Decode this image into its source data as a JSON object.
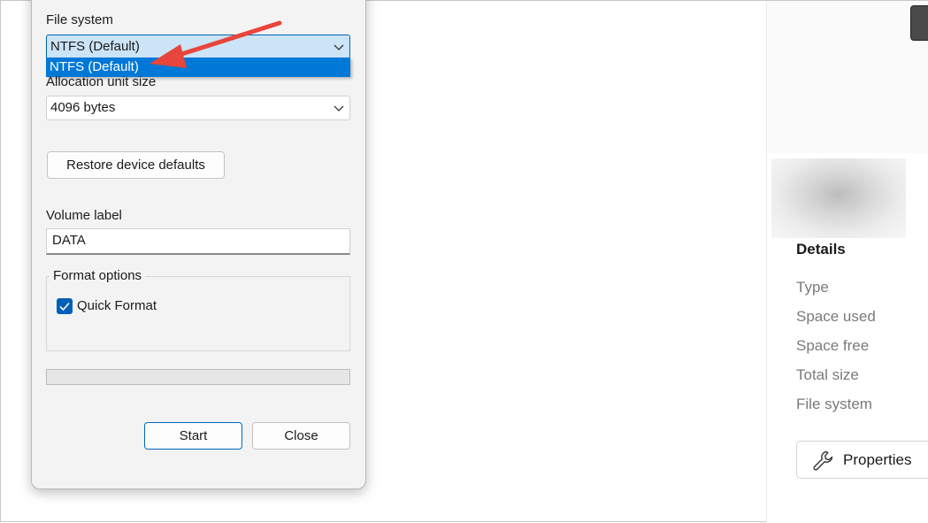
{
  "dialog": {
    "file_system_label": "File system",
    "file_system_value": "NTFS (Default)",
    "dropdown_option": "NTFS (Default)",
    "allocation_label": "Allocation unit size",
    "allocation_value": "4096 bytes",
    "restore_button": "Restore device defaults",
    "volume_label_label": "Volume label",
    "volume_label_value": "DATA",
    "format_options_title": "Format options",
    "quick_format_label": "Quick Format",
    "quick_format_checked": true,
    "start_button": "Start",
    "close_button": "Close"
  },
  "details_panel": {
    "title": "Details",
    "rows": [
      "Type",
      "Space used",
      "Space free",
      "Total size",
      "File system"
    ],
    "properties_button": "Properties"
  },
  "annotation": {
    "arrow_color": "#e8453c",
    "arrow_icon": "red-arrow-pointer"
  },
  "colors": {
    "accent": "#0078d7",
    "checkbox": "#005fb8",
    "dialog_bg": "#f3f3f3"
  }
}
